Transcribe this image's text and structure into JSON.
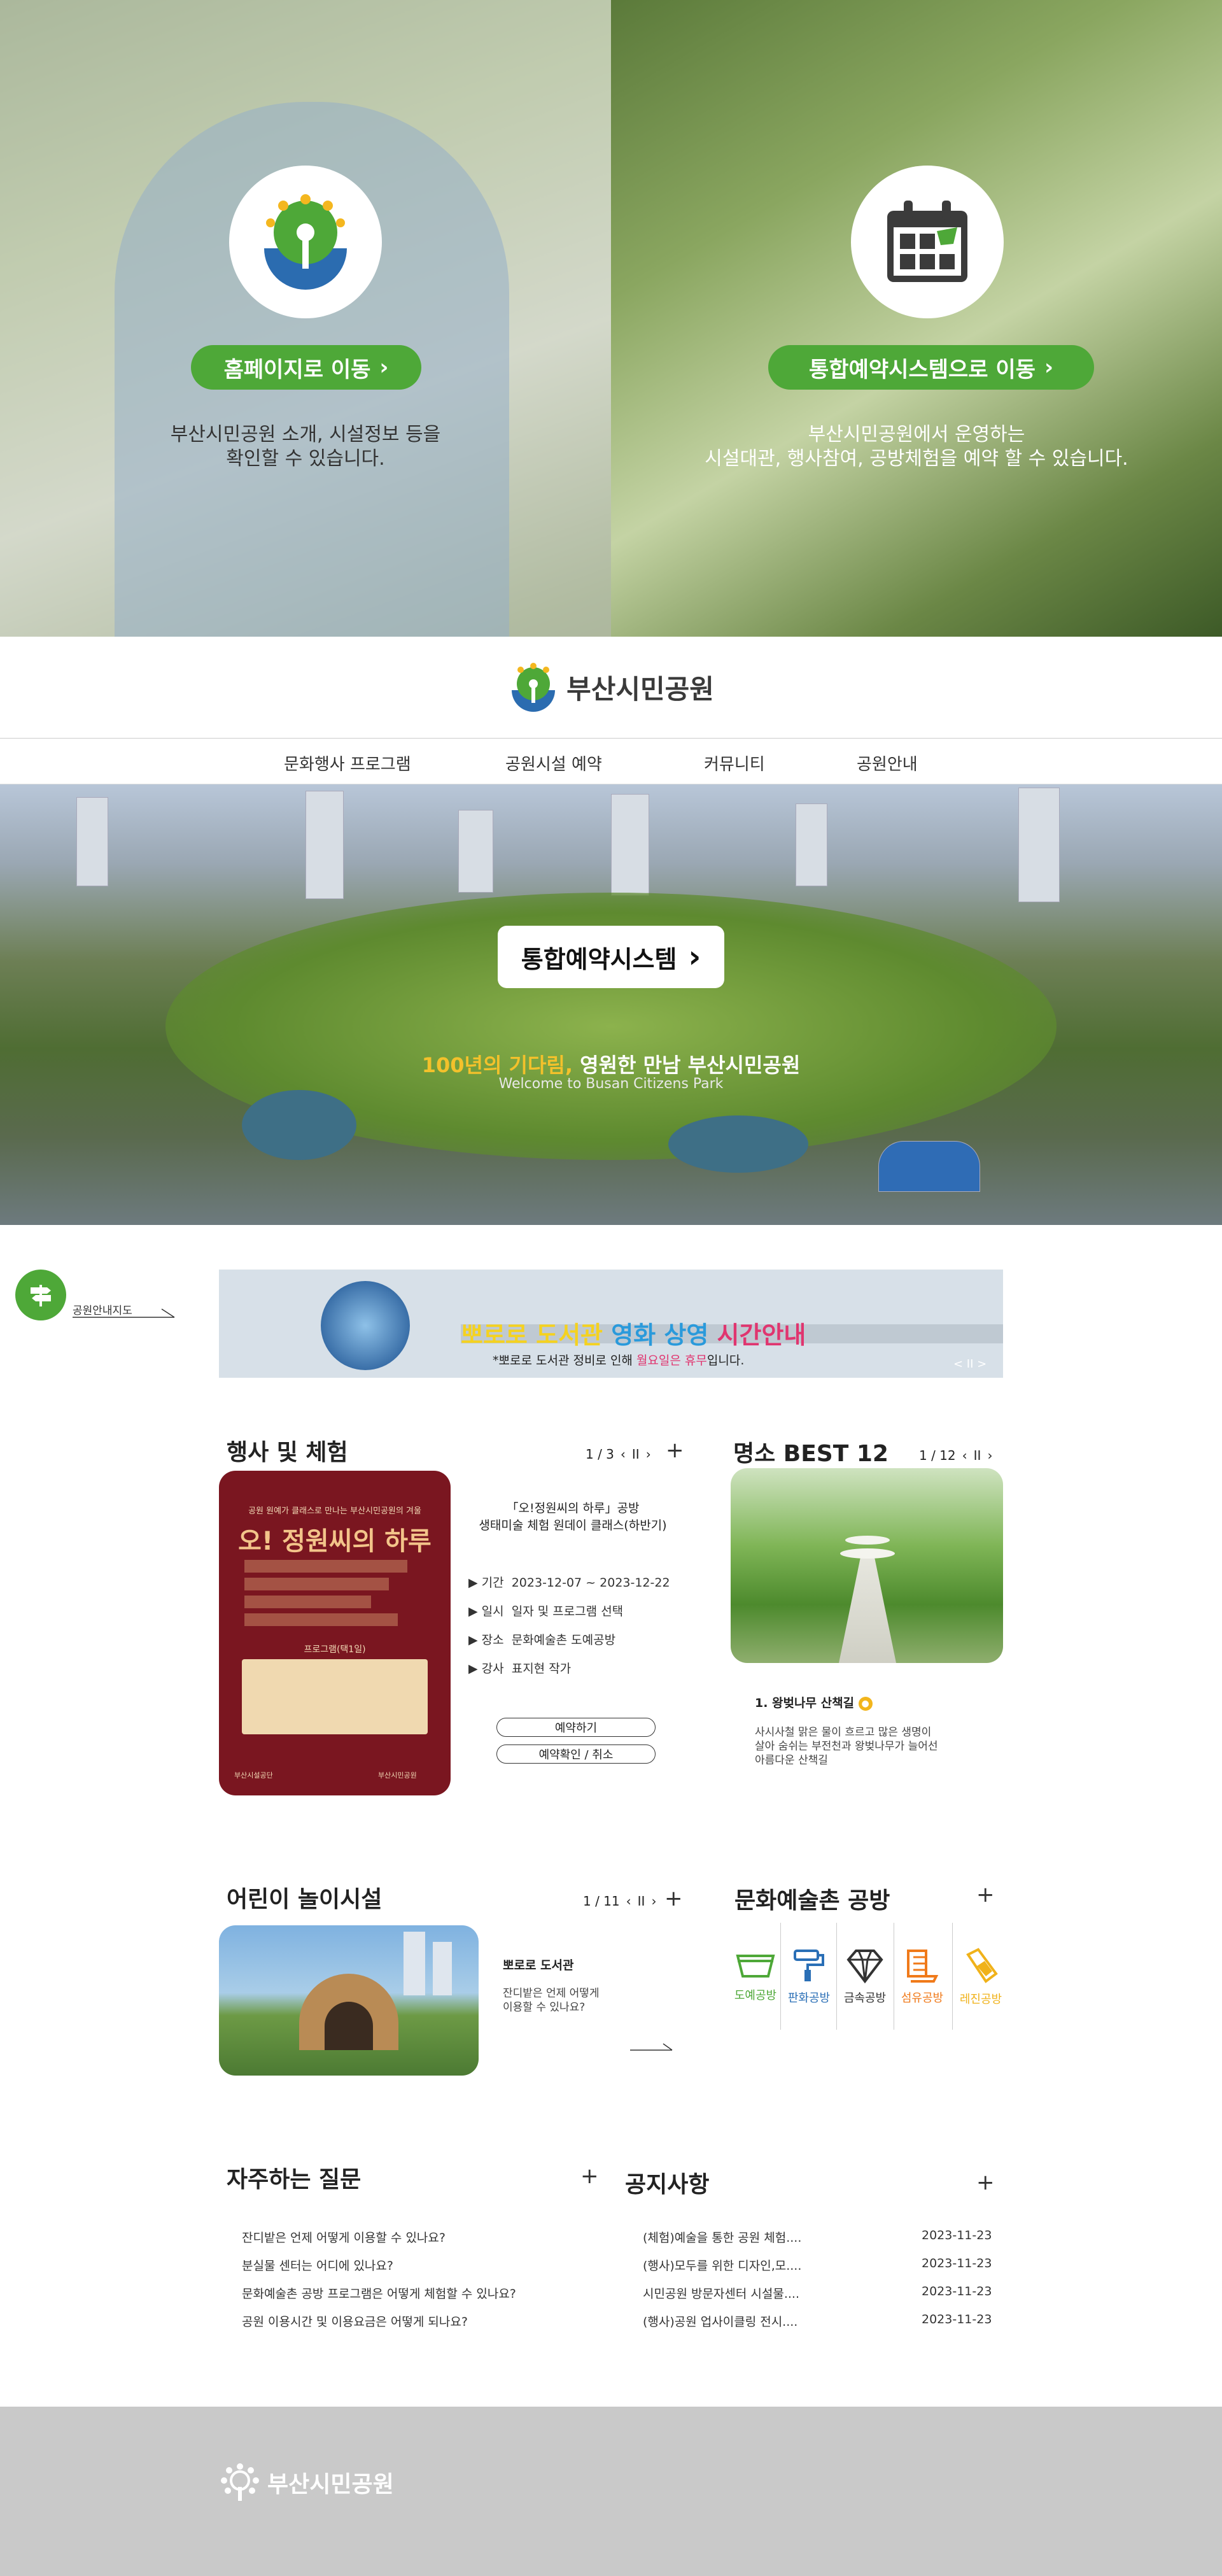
{
  "hero": {
    "left": {
      "button_label": "홈페이지로 이동",
      "desc_line1": "부산시민공원 소개, 시설정보 등을",
      "desc_line2": "확인할 수 있습니다."
    },
    "right": {
      "button_label": "통합예약시스템으로 이동",
      "desc_line1": "부산시민공원에서 운영하는",
      "desc_line2": "시설대관, 행사참여, 공방체험을 예약 할 수 있습니다."
    }
  },
  "site": {
    "logo_text": "부산시민공원"
  },
  "nav": {
    "items": [
      "문화행사 프로그램",
      "공원시설 예약",
      "커뮤니티",
      "공원안내"
    ]
  },
  "banner": {
    "button_label": "통합예약시스템",
    "title_highlight": "100년의 기다림,",
    "title_rest": " 영원한 만남 부산시민공원",
    "subtitle": "Welcome to Busan Citizens Park"
  },
  "side": {
    "map_label": "공원안내지도"
  },
  "notice_banner": {
    "title_a": "뽀로로 도서관",
    "title_b": "영화 상영",
    "title_c": "시간안내",
    "subtitle_a": "*뽀로로 도서관 정비로 인해",
    "subtitle_b": "월요일은 휴무",
    "subtitle_c": "입니다.",
    "pager": "< II >"
  },
  "events": {
    "title": "행사 및 체험",
    "page": "1 / 3",
    "poster": {
      "top_text": "공원 원예가 클래스로 만나는 부산시민공원의 겨울",
      "title": "오! 정원씨의 하루",
      "table_title": "프로그램(택1일)",
      "footer_left": "부산시설공단",
      "footer_right": "부산시민공원"
    },
    "name_line1": "「오!정원씨의 하루」공방",
    "name_line2": "생태미술 체험 원데이 클래스(하반기)",
    "details": [
      {
        "label": "기간",
        "value": "2023-12-07 ~ 2023-12-22"
      },
      {
        "label": "일시",
        "value": "일자 및 프로그램 선택"
      },
      {
        "label": "장소",
        "value": "문화예술촌 도예공방"
      },
      {
        "label": "강사",
        "value": "표지현 작가"
      }
    ],
    "reserve_btn": "예약하기",
    "check_btn": "예약확인 / 취소"
  },
  "best": {
    "title": "명소 BEST 12",
    "page": "1 / 12",
    "item_title": "1. 왕벚나무 산책길",
    "desc_line1": "사시사철 맑은 물이 흐르고 많은 생명이",
    "desc_line2": "살아 숨쉬는 부전천과 왕벚나무가 늘어선",
    "desc_line3": "아름다운 산책길"
  },
  "kids": {
    "title": "어린이 놀이시설",
    "page": "1 / 11",
    "item_title": "뽀로로 도서관",
    "desc_line1": "잔디밭은 언제 어떻게",
    "desc_line2": "이용할 수 있나요?"
  },
  "crafts": {
    "title": "문화예술촌 공방",
    "items": [
      {
        "label": "도예공방",
        "color": "#4ea838"
      },
      {
        "label": "판화공방",
        "color": "#2a6fb6"
      },
      {
        "label": "금속공방",
        "color": "#333333"
      },
      {
        "label": "섬유공방",
        "color": "#f07a1a"
      },
      {
        "label": "레진공방",
        "color": "#f0b21a"
      }
    ]
  },
  "faq": {
    "title": "자주하는 질문",
    "items": [
      "잔디밭은 언제 어떻게 이용할 수 있나요?",
      "분실물 센터는 어디에 있나요?",
      "문화예술촌 공방 프로그램은 어떻게 체험할 수 있나요?",
      "공원 이용시간 및 이용요금은 어떻게 되나요?"
    ]
  },
  "notices": {
    "title": "공지사항",
    "items": [
      {
        "title": "(체험)예술을 통한 공원 체험....",
        "date": "2023-11-23"
      },
      {
        "title": "(행사)모두를 위한 디자인,모....",
        "date": "2023-11-23"
      },
      {
        "title": "시민공원 방문자센터 시설물....",
        "date": "2023-11-23"
      },
      {
        "title": "(행사)공원 업사이클링 전시....",
        "date": "2023-11-23"
      }
    ]
  },
  "footer": {
    "logo_text": "부산시민공원"
  }
}
